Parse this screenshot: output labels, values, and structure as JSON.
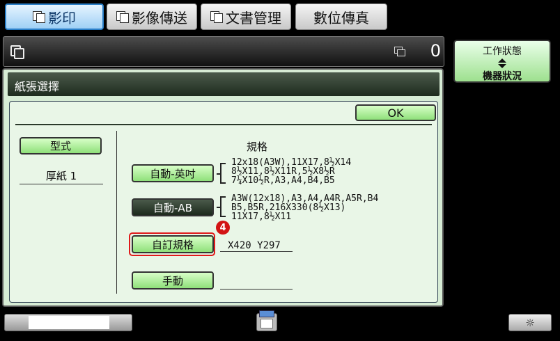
{
  "tabs": [
    {
      "label": "影印",
      "active": true
    },
    {
      "label": "影像傳送",
      "active": false
    },
    {
      "label": "文書管理",
      "active": false
    },
    {
      "label": "數位傳真",
      "active": false
    }
  ],
  "status": {
    "copy_count": "0"
  },
  "job_status": {
    "line1": "工作狀態",
    "line2": "機器狀況"
  },
  "panel": {
    "title": "紙張選擇",
    "ok_label": "OK",
    "type_label": "型式",
    "type_value": "厚紙 1",
    "size_header": "規格",
    "auto_inch_label": "自動-英吋",
    "auto_inch_sizes": [
      "12x18(A3W),11X17,8½X14",
      "8½X11,8½X11R,5½X8½R",
      "7¼X10½R,A3,A4,B4,B5"
    ],
    "auto_ab_label": "自動-AB",
    "auto_ab_sizes": [
      "A3W(12x18),A3,A4,A4R,A5R,B4",
      "B5,B5R,216X330(8½X13)",
      "11X17,8½X11"
    ],
    "step_badge": "4",
    "custom_label": "自訂規格",
    "custom_value": "X420 Y297",
    "manual_label": "手動"
  },
  "bottom": {
    "brightness_symbol": "☼"
  },
  "icons": {
    "copy": "copy-mode-icon",
    "pages": "pages-icon",
    "job_arrows": "up-down-arrow-icon"
  },
  "colors": {
    "accent_green": "#8fe07a",
    "highlight_red": "#e01a1a",
    "active_tab_blue": "#2a7fc8"
  }
}
